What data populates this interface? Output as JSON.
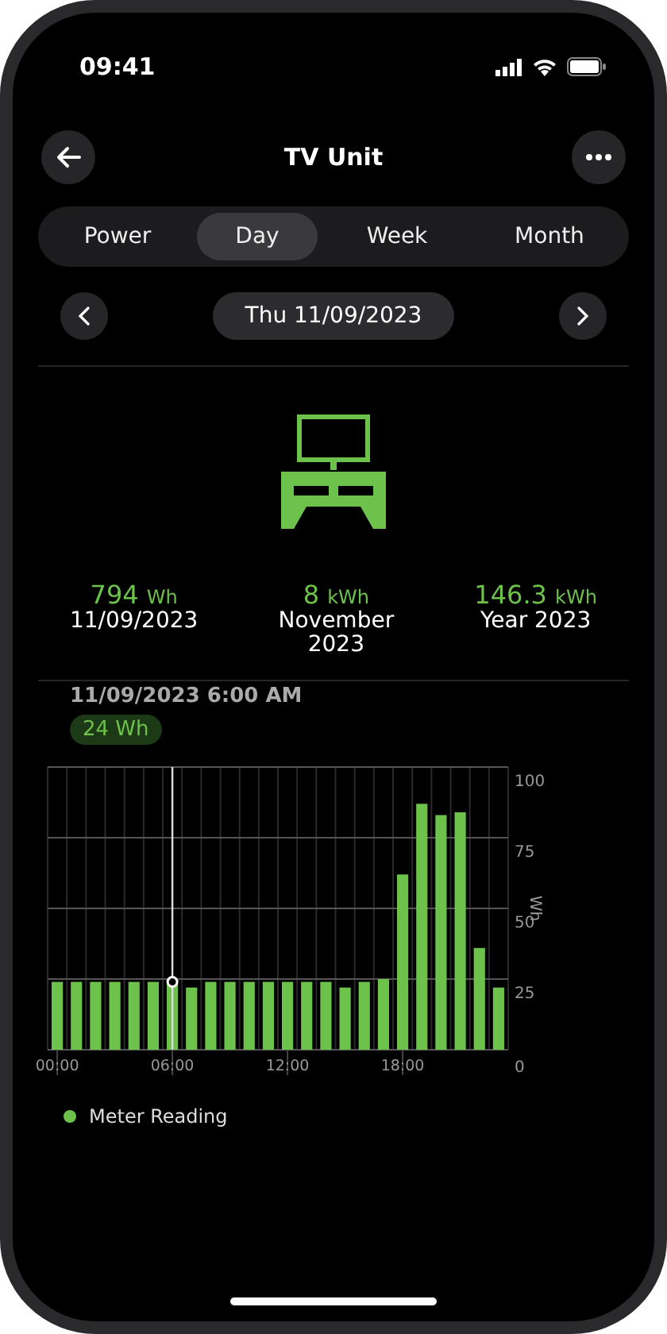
{
  "status_bar": {
    "time": "09:41"
  },
  "header": {
    "title": "TV Unit"
  },
  "tabs": [
    {
      "label": "Power",
      "selected": false
    },
    {
      "label": "Day",
      "selected": true
    },
    {
      "label": "Week",
      "selected": false
    },
    {
      "label": "Month",
      "selected": false
    }
  ],
  "date_nav": {
    "date": "Thu 11/09/2023"
  },
  "stats": [
    {
      "value": "794",
      "unit": "Wh",
      "label": "11/09/2023"
    },
    {
      "value": "8",
      "unit": "kWh",
      "label": "November 2023"
    },
    {
      "value": "146.3",
      "unit": "kWh",
      "label": "Year 2023"
    }
  ],
  "reading": {
    "time": "11/09/2023 6:00 AM",
    "value": "24 Wh"
  },
  "chart": {
    "chart_data": {
      "type": "bar",
      "ylabel": "Wh",
      "x": [
        0,
        1,
        2,
        3,
        4,
        5,
        6,
        7,
        8,
        9,
        10,
        11,
        12,
        13,
        14,
        15,
        16,
        17,
        18,
        19,
        20,
        21,
        22,
        23
      ],
      "series": [
        {
          "name": "Meter Reading",
          "color": "#6cc24a",
          "values": [
            24,
            24,
            24,
            24,
            24,
            24,
            24,
            22,
            24,
            24,
            24,
            24,
            24,
            24,
            24,
            22,
            24,
            25,
            62,
            87,
            83,
            84,
            36,
            22
          ]
        }
      ],
      "xlim": [
        -0.5,
        23.5
      ],
      "ylim": [
        0,
        100
      ],
      "yticks": [
        0,
        25,
        50,
        75,
        100
      ],
      "grid": true,
      "xticks": [
        {
          "value": 0,
          "label": "00:00"
        },
        {
          "value": 6,
          "label": "06:00"
        },
        {
          "value": 12,
          "label": "12:00"
        },
        {
          "value": 18,
          "label": "18:00"
        }
      ],
      "ref_lines": [
        {
          "axis": "x",
          "value": 6,
          "color": "#dddddd"
        }
      ]
    }
  }
}
